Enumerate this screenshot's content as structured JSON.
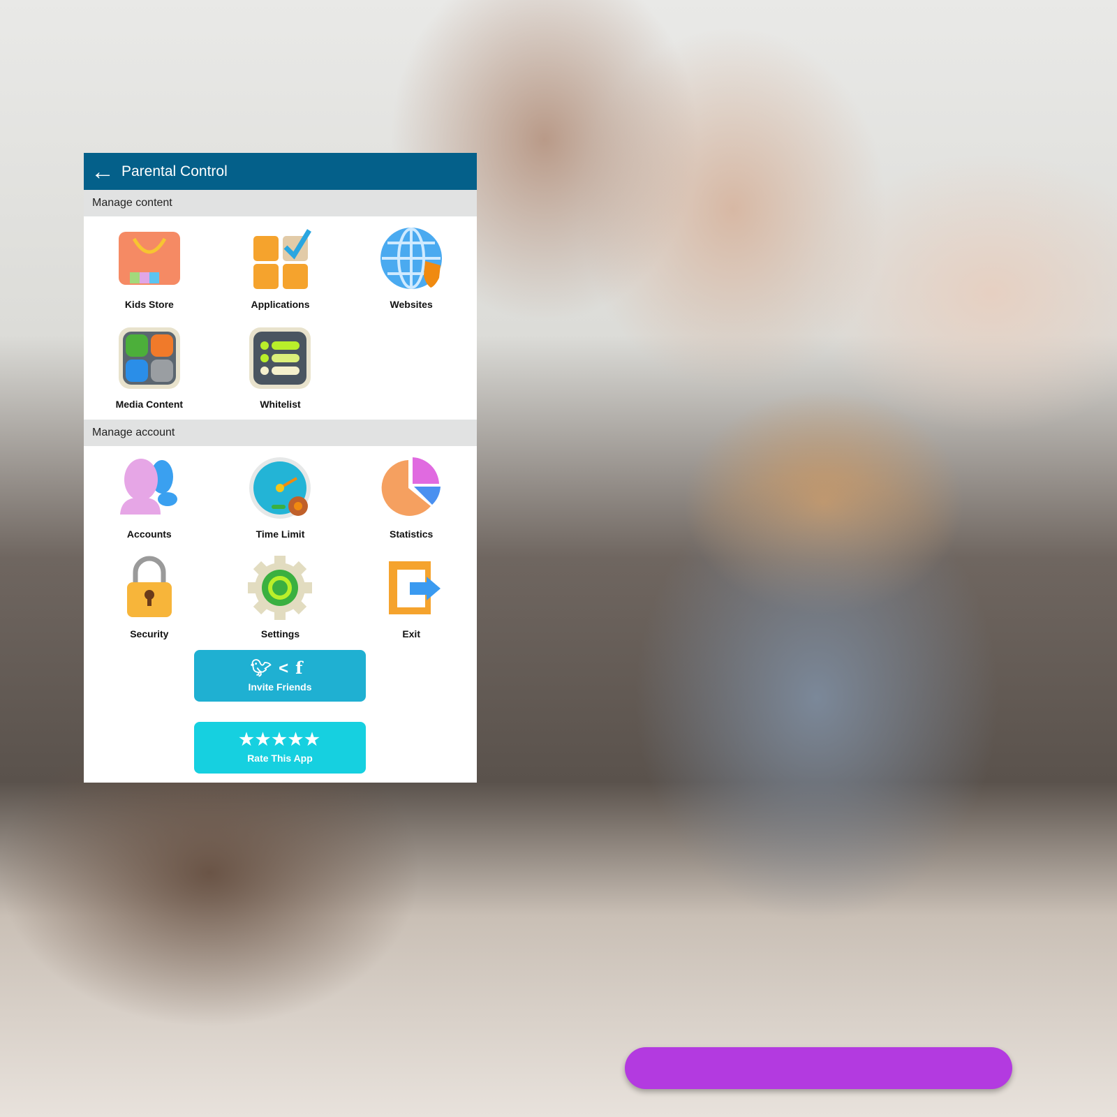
{
  "header": {
    "title": "Parental Control",
    "back_icon": "arrow-left-icon"
  },
  "sections": [
    {
      "title": "Manage content",
      "items": [
        {
          "label": "Kids Store",
          "icon": "shopping-bag-icon"
        },
        {
          "label": "Applications",
          "icon": "apps-checkmark-icon"
        },
        {
          "label": "Websites",
          "icon": "globe-shield-icon"
        },
        {
          "label": "Media Content",
          "icon": "media-folder-icon"
        },
        {
          "label": "Whitelist",
          "icon": "list-icon"
        }
      ]
    },
    {
      "title": "Manage account",
      "items": [
        {
          "label": "Accounts",
          "icon": "users-icon"
        },
        {
          "label": "Time Limit",
          "icon": "speedometer-lock-icon"
        },
        {
          "label": "Statistics",
          "icon": "pie-chart-icon"
        },
        {
          "label": "Security",
          "icon": "padlock-icon"
        },
        {
          "label": "Settings",
          "icon": "gear-icon"
        },
        {
          "label": "Exit",
          "icon": "exit-door-icon"
        }
      ]
    }
  ],
  "buttons": {
    "invite": {
      "label": "Invite Friends",
      "icons": [
        "twitter-icon",
        "share-icon",
        "facebook-icon"
      ],
      "color": "#1fb0d2"
    },
    "rate": {
      "label": "Rate This App",
      "stars": 5,
      "color": "#16d0e0"
    }
  }
}
